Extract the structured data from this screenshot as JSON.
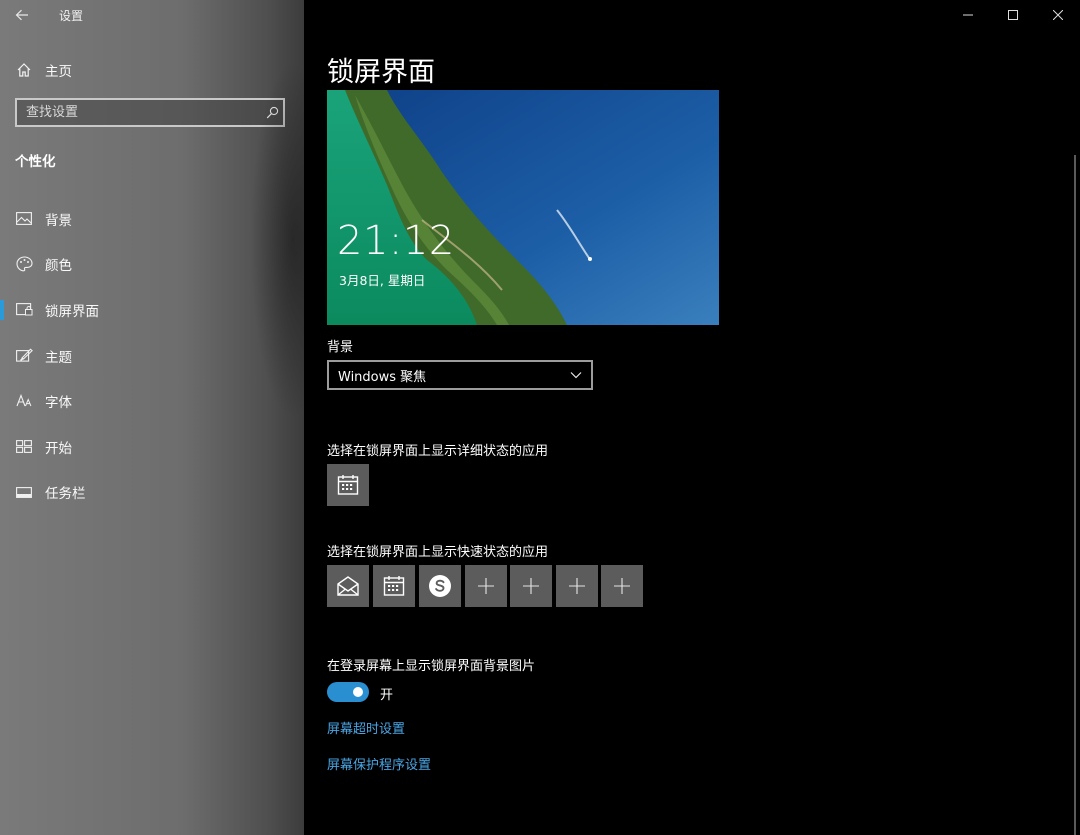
{
  "sidebar": {
    "app_title": "设置",
    "home_label": "主页",
    "search": {
      "placeholder": "查找设置"
    },
    "section_title": "个性化",
    "items": [
      {
        "label": "背景",
        "icon": "picture-icon"
      },
      {
        "label": "颜色",
        "icon": "palette-icon"
      },
      {
        "label": "锁屏界面",
        "icon": "lock-screen-icon",
        "selected": true
      },
      {
        "label": "主题",
        "icon": "theme-brush-icon"
      },
      {
        "label": "字体",
        "icon": "font-icon"
      },
      {
        "label": "开始",
        "icon": "start-grid-icon"
      },
      {
        "label": "任务栏",
        "icon": "taskbar-icon"
      }
    ],
    "accent_color": "#2a9bd8"
  },
  "main": {
    "page_title": "锁屏界面",
    "preview": {
      "time": "21:12",
      "date": "3月8日, 星期日"
    },
    "background": {
      "label": "背景",
      "selected": "Windows 聚焦"
    },
    "detailed_status": {
      "label": "选择在锁屏界面上显示详细状态的应用",
      "apps": [
        "calendar-icon"
      ]
    },
    "quick_status": {
      "label": "选择在锁屏界面上显示快速状态的应用",
      "apps": [
        "mail-icon",
        "calendar-icon",
        "skype-icon",
        "plus-icon",
        "plus-icon",
        "plus-icon",
        "plus-icon"
      ]
    },
    "login_background": {
      "label": "在登录屏幕上显示锁屏界面背景图片",
      "toggle_state": "开",
      "on": true
    },
    "links": {
      "timeout": "屏幕超时设置",
      "screensaver": "屏幕保护程序设置"
    },
    "link_color": "#4aa5e3",
    "toggle_color": "#2a8fd1"
  },
  "window_controls": [
    "minimize-icon",
    "maximize-icon",
    "close-icon"
  ]
}
